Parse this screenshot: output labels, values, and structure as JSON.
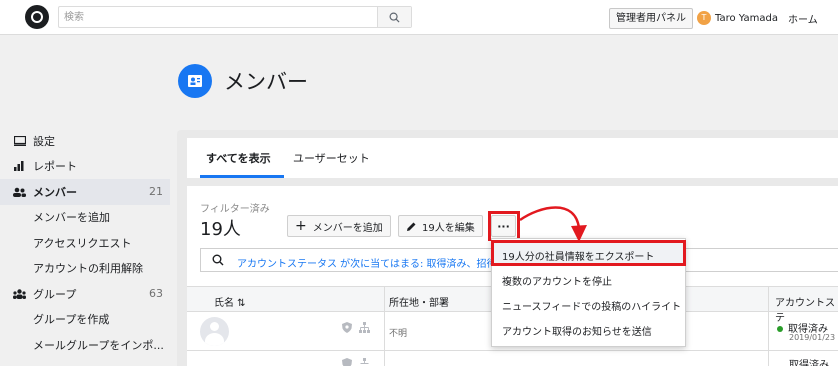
{
  "topbar": {
    "search_placeholder": "検索",
    "admin_button": "管理者用パネル",
    "user_initial": "T",
    "user_name": "Taro Yamada",
    "home_link": "ホーム"
  },
  "page": {
    "title": "メンバー"
  },
  "sidebar": {
    "items": [
      {
        "label": "設定",
        "icon": "monitor-icon"
      },
      {
        "label": "レポート",
        "icon": "bar-chart-icon"
      },
      {
        "label": "メンバー",
        "icon": "people-icon",
        "count": "21",
        "active": true
      },
      {
        "label": "メンバーを追加"
      },
      {
        "label": "アクセスリクエスト"
      },
      {
        "label": "アカウントの利用解除"
      },
      {
        "label": "グループ",
        "icon": "group-icon",
        "count": "63"
      },
      {
        "label": "グループを作成"
      },
      {
        "label": "メールグループをインポ..."
      }
    ]
  },
  "tabs": [
    {
      "label": "すべてを表示",
      "active": true
    },
    {
      "label": "ユーザーセット"
    }
  ],
  "summary": {
    "filter_label": "フィルター済み",
    "count": "19人"
  },
  "toolbar": {
    "add_member": "メンバーを追加",
    "edit_people": "19人を編集",
    "more": "···"
  },
  "filter": {
    "text": "アカウントステータス が次に当てはまる: 取得済み、招待済"
  },
  "table": {
    "headers": [
      "氏名 ⇅",
      "所在地・部署",
      "アカウントステ"
    ],
    "rows": [
      {
        "location": "不明",
        "status": "取得済み",
        "date": "2019/01/23"
      },
      {
        "location": "",
        "status": "取得済み",
        "date": ""
      }
    ]
  },
  "dropdown": {
    "items": [
      "19人分の社員情報をエクスポート",
      "複数のアカウントを停止",
      "ニュースフィードでの投稿のハイライト",
      "アカウント取得のお知らせを送信"
    ]
  },
  "colors": {
    "accent": "#1877f2",
    "highlight": "#e2191f",
    "status_ok": "#2a9d2a"
  }
}
